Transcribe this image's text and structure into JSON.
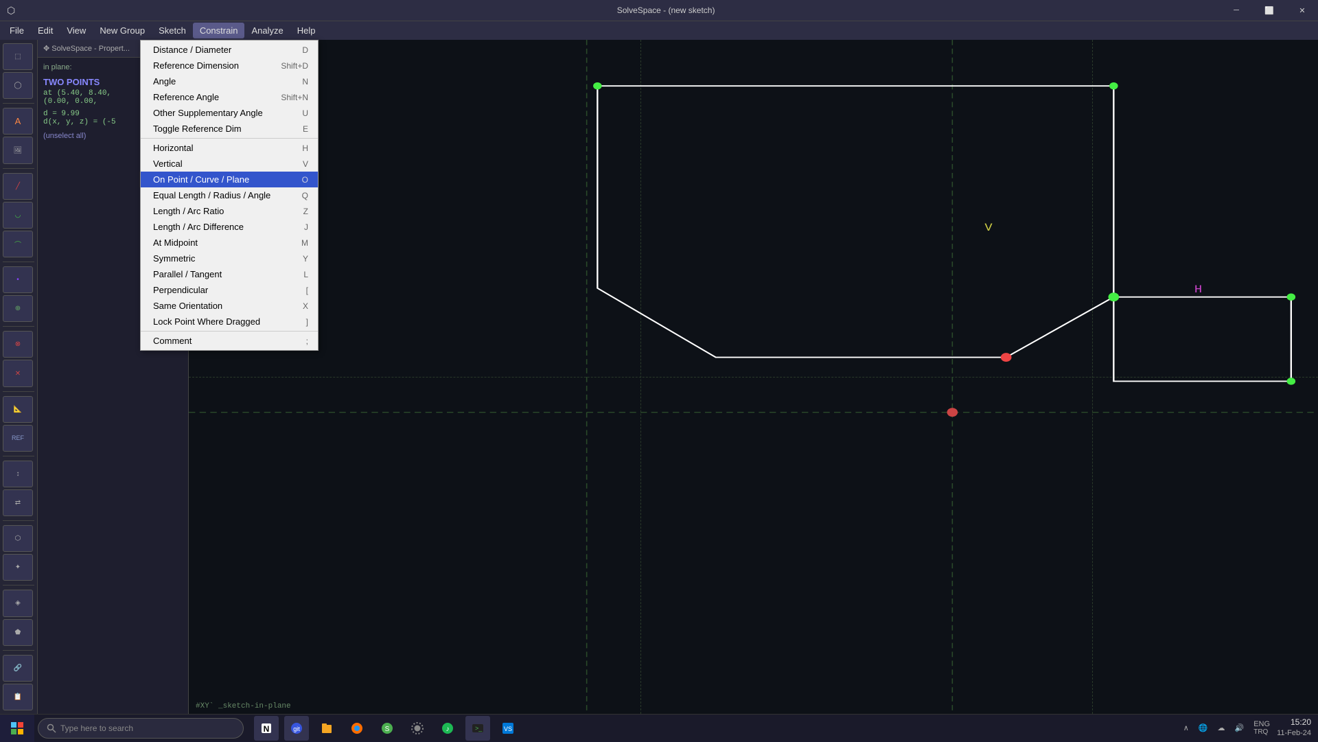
{
  "titlebar": {
    "title": "SolveSpace - (new sketch)",
    "icon": "⬡",
    "minimize": "─",
    "maximize": "⬜",
    "close": "✕"
  },
  "menubar": {
    "items": [
      "File",
      "Edit",
      "View",
      "New Group",
      "Sketch",
      "Constrain",
      "Analyze",
      "Help"
    ]
  },
  "constrain_menu": {
    "items": [
      {
        "label": "Distance / Diameter",
        "shortcut": "D",
        "highlighted": false
      },
      {
        "label": "Reference Dimension",
        "shortcut": "Shift+D",
        "highlighted": false
      },
      {
        "label": "Angle",
        "shortcut": "N",
        "highlighted": false
      },
      {
        "label": "Reference Angle",
        "shortcut": "Shift+N",
        "highlighted": false
      },
      {
        "label": "Other Supplementary Angle",
        "shortcut": "U",
        "highlighted": false
      },
      {
        "label": "Toggle Reference Dim",
        "shortcut": "E",
        "highlighted": false
      },
      {
        "separator": true
      },
      {
        "label": "Horizontal",
        "shortcut": "H",
        "highlighted": false
      },
      {
        "label": "Vertical",
        "shortcut": "V",
        "highlighted": false
      },
      {
        "label": "On Point / Curve / Plane",
        "shortcut": "O",
        "highlighted": true
      },
      {
        "label": "Equal Length / Radius / Angle",
        "shortcut": "Q",
        "highlighted": false
      },
      {
        "label": "Length / Arc Ratio",
        "shortcut": "Z",
        "highlighted": false
      },
      {
        "label": "Length / Arc Difference",
        "shortcut": "J",
        "highlighted": false
      },
      {
        "label": "At Midpoint",
        "shortcut": "M",
        "highlighted": false
      },
      {
        "label": "Symmetric",
        "shortcut": "Y",
        "highlighted": false
      },
      {
        "label": "Parallel / Tangent",
        "shortcut": "L",
        "highlighted": false
      },
      {
        "label": "Perpendicular",
        "shortcut": "[",
        "highlighted": false
      },
      {
        "label": "Same Orientation",
        "shortcut": "X",
        "highlighted": false
      },
      {
        "label": "Lock Point Where Dragged",
        "shortcut": "]",
        "highlighted": false
      },
      {
        "separator2": true
      },
      {
        "label": "Comment",
        "shortcut": ";",
        "highlighted": false
      }
    ]
  },
  "side_panel": {
    "title": "✥ SolveSpace - Propert...",
    "in_plane": "in plane:",
    "two_points": "TWO POINTS",
    "coords": "at (5.40, 8.40,",
    "coords2": "(0.00, 0.00,",
    "distance": "d = 9.99",
    "delta": "d(x, y, z) = (-5",
    "unselect": "(unselect all)"
  },
  "canvas": {
    "label_v": "V",
    "label_h": "H",
    "sketch_label": "#XY` _sketch-in-plane"
  },
  "taskbar": {
    "search_placeholder": "Type here to search",
    "tray_lang": "ENG",
    "tray_layout": "TRQ",
    "time": "15:20",
    "date": "11-Feb-24"
  },
  "toolbar_tools": [
    "⬚",
    "◯",
    "A",
    "🖼",
    "╱",
    "◡",
    "⌒",
    "•",
    "⊕",
    "⊗",
    "✕",
    "📐",
    "⊞",
    "↕",
    "⇄",
    "⬡",
    "✦",
    "◈",
    "⬟",
    "🔗",
    "📋"
  ]
}
